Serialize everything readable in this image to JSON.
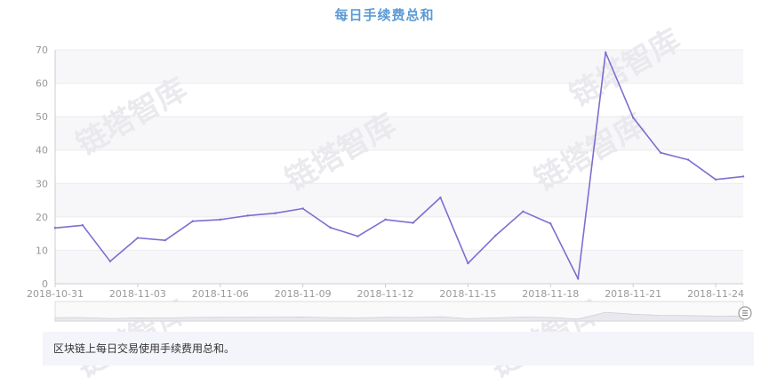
{
  "title": "每日手续费总和",
  "watermark": "链塔智库",
  "description": "区块链上每日交易使用手续费用总和。",
  "chart_data": {
    "type": "line",
    "title": "每日手续费总和",
    "xlabel": "",
    "ylabel": "",
    "ylim": [
      0,
      70
    ],
    "yticks": [
      0,
      10,
      20,
      30,
      40,
      50,
      60,
      70
    ],
    "x": [
      "2018-10-31",
      "2018-11-01",
      "2018-11-02",
      "2018-11-03",
      "2018-11-04",
      "2018-11-05",
      "2018-11-06",
      "2018-11-07",
      "2018-11-08",
      "2018-11-09",
      "2018-11-10",
      "2018-11-11",
      "2018-11-12",
      "2018-11-13",
      "2018-11-14",
      "2018-11-15",
      "2018-11-16",
      "2018-11-17",
      "2018-11-18",
      "2018-11-19",
      "2018-11-20",
      "2018-11-21",
      "2018-11-22",
      "2018-11-23",
      "2018-11-24",
      "2018-11-25"
    ],
    "xticks": [
      "2018-10-31",
      "2018-11-03",
      "2018-11-06",
      "2018-11-09",
      "2018-11-12",
      "2018-11-15",
      "2018-11-18",
      "2018-11-21",
      "2018-11-24"
    ],
    "series": [
      {
        "values": [
          16.7,
          17.5,
          6.7,
          13.7,
          13.0,
          18.7,
          19.2,
          20.4,
          21.1,
          22.5,
          16.8,
          14.2,
          19.2,
          18.2,
          25.8,
          6.1,
          14.4,
          21.6,
          18.0,
          1.5,
          69.2,
          49.7,
          39.2,
          37.1,
          31.2,
          32.1
        ]
      }
    ],
    "line_color": "#7b6fd0",
    "grid": true,
    "band_colors": [
      "#f7f7f9",
      "#ffffff"
    ],
    "data_zoom": true
  }
}
